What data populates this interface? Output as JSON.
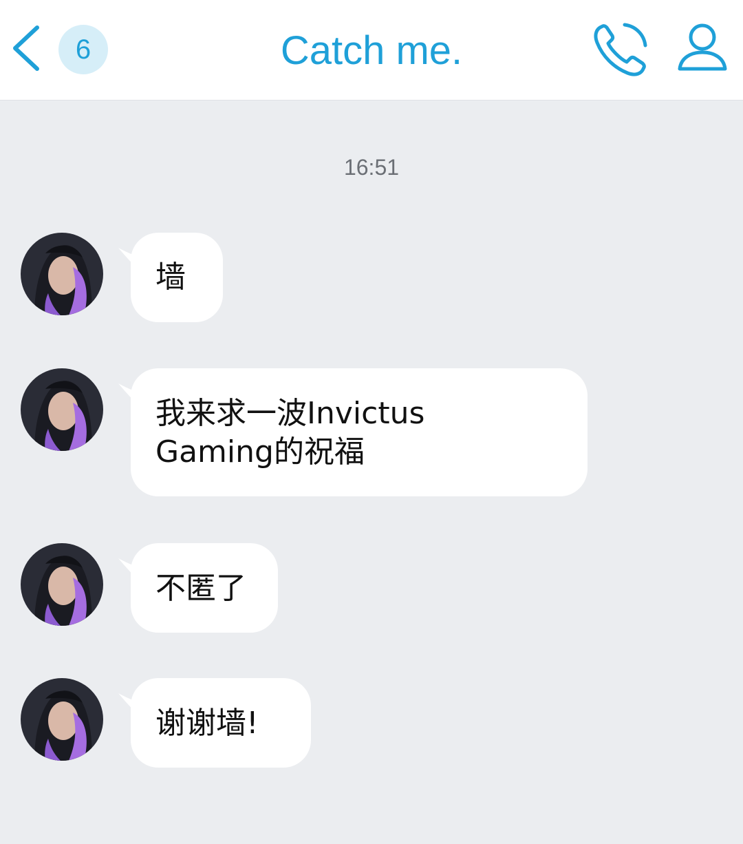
{
  "header": {
    "back_icon": "chevron-left-icon",
    "unread_count": "6",
    "title": "Catch me.",
    "call_icon": "phone-icon",
    "profile_icon": "person-icon",
    "accent_color": "#1fa0d8"
  },
  "chat": {
    "timestamp": "16:51",
    "messages": [
      {
        "sender": "contact",
        "text": "墙"
      },
      {
        "sender": "contact",
        "text": "我来求一波Invictus\nGaming的祝福"
      },
      {
        "sender": "contact",
        "text": "不匿了"
      },
      {
        "sender": "contact",
        "text": "谢谢墙!"
      }
    ]
  }
}
